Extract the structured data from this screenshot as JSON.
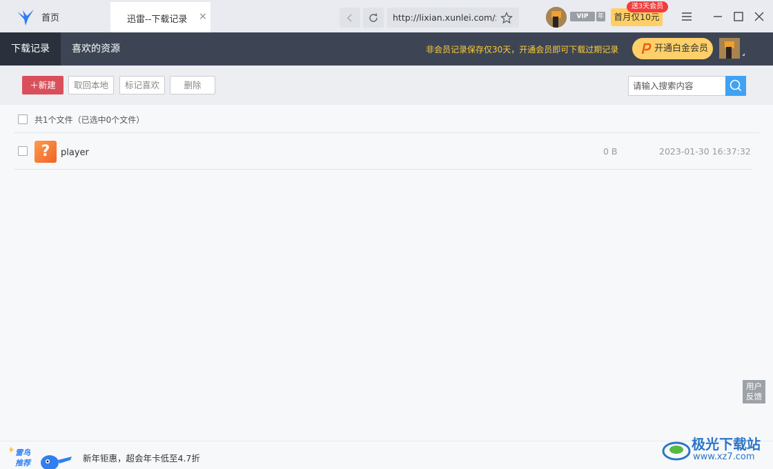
{
  "titlebar": {
    "home_tab_label": "首页",
    "active_tab_label": "迅雷--下载记录",
    "close_glyph": "×",
    "url": "http://lixian.xunlei.com/xl9",
    "vip_badge": "VIP",
    "year_badge": "年",
    "promo_button": "首月仅10元",
    "promo_flag": "送3天会员"
  },
  "navbar": {
    "tabs": [
      {
        "label": "下载记录"
      },
      {
        "label": "喜欢的资源"
      }
    ],
    "notice": "非会员记录保存仅30天，开通会员即可下载过期记录",
    "vip_button": "开通白金会员"
  },
  "toolbar": {
    "new_label": "新建",
    "retrieve_label": "取回本地",
    "mark_label": "标记喜欢",
    "delete_label": "删除",
    "search_placeholder": "请输入搜索内容"
  },
  "list": {
    "summary": "共1个文件（已选中0个文件）",
    "rows": [
      {
        "icon": "?",
        "name": "player",
        "size": "0 B",
        "date": "2023-01-30 16:37:32"
      }
    ]
  },
  "feedback": {
    "line1": "用户",
    "line2": "反馈"
  },
  "footer": {
    "mascot_text": "雷鸟推荐",
    "promo": "新年钜惠，超会年卡低至4.7折"
  },
  "watermark": {
    "title": "极光下载站",
    "url": "www.xz7.com"
  },
  "colors": {
    "navbar_bg": "#3d4555",
    "notice": "#ffcc33",
    "new_button": "#d9505c",
    "search_button": "#3fa2f3",
    "vip_button": "#ffd06a"
  }
}
